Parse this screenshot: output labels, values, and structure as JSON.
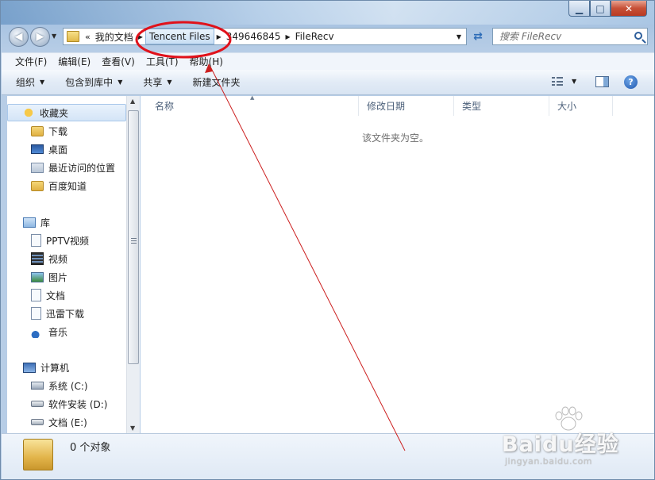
{
  "window": {
    "minimize_glyph": "▁",
    "maximize_glyph": "□",
    "close_glyph": "✕"
  },
  "nav": {
    "back_glyph": "◀",
    "forward_glyph": "▶",
    "dropdown_glyph": "▼"
  },
  "address": {
    "overflow": "«",
    "crumbs": [
      "我的文档",
      "Tencent Files",
      "349646845",
      "FileRecv"
    ],
    "separator": "▶",
    "dropdown_glyph": "▼",
    "refresh_glyph": "⇄"
  },
  "search": {
    "placeholder": "搜索 FileRecv"
  },
  "menubar": {
    "items": [
      "文件(F)",
      "编辑(E)",
      "查看(V)",
      "工具(T)",
      "帮助(H)"
    ]
  },
  "commandbar": {
    "organize": "组织",
    "include_in_library": "包含到库中",
    "share": "共享",
    "new_folder": "新建文件夹",
    "caret": "▼",
    "help_glyph": "?"
  },
  "navpane": {
    "favorites": "收藏夹",
    "downloads": "下载",
    "desktop": "桌面",
    "recent_places": "最近访问的位置",
    "baidu_zhidao": "百度知道",
    "libraries": "库",
    "pptv_video": "PPTV视频",
    "videos": "视频",
    "pictures": "图片",
    "documents": "文档",
    "xunlei_download": "迅雷下载",
    "music": "音乐",
    "computer": "计算机",
    "drive_c": "系统 (C:)",
    "drive_d": "软件安装 (D:)",
    "drive_e": "文档 (E:)"
  },
  "scrollbar": {
    "up_glyph": "▲",
    "down_glyph": "▼"
  },
  "content": {
    "columns": [
      "名称",
      "修改日期",
      "类型",
      "大小"
    ],
    "sort_glyph": "▲",
    "empty_message": "该文件夹为空。"
  },
  "details": {
    "item_count": "0 个对象"
  },
  "annotation": {
    "highlight_color": "#e0121b",
    "arrow_color": "#cc1f1f"
  },
  "watermark": {
    "brand": "Baidu经验",
    "url": "jingyan.baidu.com"
  }
}
